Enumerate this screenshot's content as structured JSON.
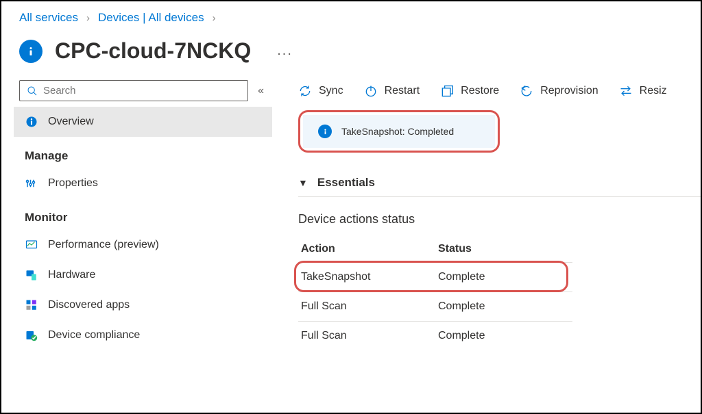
{
  "breadcrumb": {
    "level1": "All services",
    "level2": "Devices | All devices"
  },
  "page": {
    "title": "CPC-cloud-7NCKQ",
    "more": "..."
  },
  "search": {
    "placeholder": "Search"
  },
  "sidebar": {
    "overview": "Overview",
    "manage_header": "Manage",
    "properties": "Properties",
    "monitor_header": "Monitor",
    "items": [
      {
        "label": "Performance (preview)"
      },
      {
        "label": "Hardware"
      },
      {
        "label": "Discovered apps"
      },
      {
        "label": "Device compliance"
      }
    ]
  },
  "toolbar": {
    "sync": "Sync",
    "restart": "Restart",
    "restore": "Restore",
    "reprovision": "Reprovision",
    "resize": "Resiz"
  },
  "notice": {
    "text": "TakeSnapshot: Completed"
  },
  "essentials": {
    "label": "Essentials"
  },
  "actions": {
    "heading": "Device actions status",
    "col_action": "Action",
    "col_status": "Status",
    "rows": [
      {
        "action": "TakeSnapshot",
        "status": "Complete"
      },
      {
        "action": "Full Scan",
        "status": "Complete"
      },
      {
        "action": "Full Scan",
        "status": "Complete"
      }
    ]
  }
}
